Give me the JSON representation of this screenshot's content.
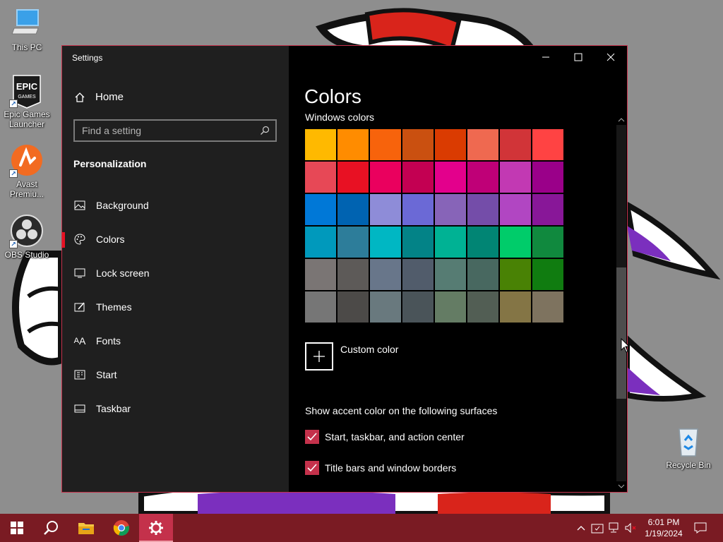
{
  "desktop": {
    "icons": [
      {
        "label": "This PC",
        "icon": "monitor-icon"
      },
      {
        "label": "Epic Games Launcher",
        "icon": "epic-games-icon",
        "logo_text": "EPIC GAMES"
      },
      {
        "label": "Avast Premiu...",
        "icon": "avast-icon"
      },
      {
        "label": "OBS Studio",
        "icon": "obs-icon"
      },
      {
        "label": "Recycle Bin",
        "icon": "recycle-bin-icon"
      }
    ]
  },
  "window": {
    "title": "Settings",
    "controls": {
      "minimize": "minimize-icon",
      "maximize": "maximize-icon",
      "close": "close-icon"
    }
  },
  "sidebar": {
    "home_label": "Home",
    "search_placeholder": "Find a setting",
    "section": "Personalization",
    "items": [
      {
        "label": "Background",
        "icon": "picture-icon"
      },
      {
        "label": "Colors",
        "icon": "palette-icon",
        "active": true
      },
      {
        "label": "Lock screen",
        "icon": "lock-screen-icon"
      },
      {
        "label": "Themes",
        "icon": "themes-brush-icon"
      },
      {
        "label": "Fonts",
        "icon": "fonts-icon",
        "glyph": "A"
      },
      {
        "label": "Start",
        "icon": "start-icon"
      },
      {
        "label": "Taskbar",
        "icon": "taskbar-icon"
      }
    ]
  },
  "content": {
    "title": "Colors",
    "windows_colors_label": "Windows colors",
    "swatches": [
      "#FFB900",
      "#FF8C00",
      "#F7630C",
      "#CA5010",
      "#DA3B01",
      "#EF6950",
      "#D13438",
      "#FF4343",
      "#E74856",
      "#E81123",
      "#EA005E",
      "#C30052",
      "#E3008C",
      "#BF0077",
      "#C239B3",
      "#9A0089",
      "#0078D7",
      "#0063B1",
      "#8E8CD8",
      "#6B69D6",
      "#8764B8",
      "#744DA9",
      "#B146C2",
      "#881798",
      "#0099BC",
      "#2D7D9A",
      "#00B7C3",
      "#038387",
      "#00B294",
      "#018574",
      "#00CC6A",
      "#10893E",
      "#7A7574",
      "#5D5A58",
      "#68768A",
      "#515C6B",
      "#567C73",
      "#486860",
      "#498205",
      "#107C10",
      "#767676",
      "#4C4A48",
      "#69797E",
      "#4A5459",
      "#647C64",
      "#525E54",
      "#847545",
      "#7E735F"
    ],
    "custom_color_label": "Custom color",
    "surfaces_heading": "Show accent color on the following surfaces",
    "checkboxes": [
      {
        "label": "Start, taskbar, and action center",
        "checked": true
      },
      {
        "label": "Title bars and window borders",
        "checked": true
      }
    ]
  },
  "taskbar": {
    "pinned": [
      {
        "name": "start-button",
        "icon": "windows-logo-icon"
      },
      {
        "name": "search-button",
        "icon": "search-icon"
      },
      {
        "name": "file-explorer-button",
        "icon": "folder-icon"
      },
      {
        "name": "chrome-button",
        "icon": "chrome-icon"
      },
      {
        "name": "settings-button",
        "icon": "gear-icon",
        "active": true
      }
    ],
    "tray": {
      "icons": [
        "chevron-up-icon",
        "security-icon",
        "network-icon",
        "volume-muted-icon"
      ],
      "time": "6:01 PM",
      "date": "1/19/2024",
      "notification_icon": "notification-icon"
    }
  },
  "colors": {
    "accent": "#C4314B",
    "taskbar_bg": "#7A1B23",
    "sidebar_bg": "#1F1F1F",
    "content_bg": "#000000"
  }
}
